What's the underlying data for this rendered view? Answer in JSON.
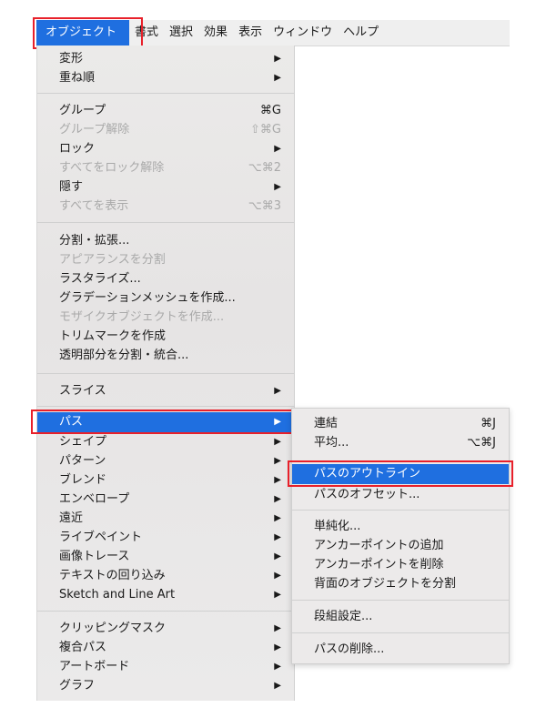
{
  "menubar": {
    "items": [
      {
        "label": "オブジェクト"
      },
      {
        "label": "書式"
      },
      {
        "label": "選択"
      },
      {
        "label": "効果"
      },
      {
        "label": "表示"
      },
      {
        "label": "ウィンドウ"
      },
      {
        "label": "ヘルプ"
      }
    ]
  },
  "menu": {
    "items": [
      {
        "label": "変形",
        "arrow": "▶"
      },
      {
        "label": "重ね順",
        "arrow": "▶"
      },
      {
        "label": "グループ",
        "shortcut": "⌘G"
      },
      {
        "label": "グループ解除",
        "shortcut": "⇧⌘G"
      },
      {
        "label": "ロック",
        "arrow": "▶"
      },
      {
        "label": "すべてをロック解除",
        "shortcut": "⌥⌘2"
      },
      {
        "label": "隠す",
        "arrow": "▶"
      },
      {
        "label": "すべてを表示",
        "shortcut": "⌥⌘3"
      },
      {
        "label": "分割・拡張..."
      },
      {
        "label": "アピアランスを分割"
      },
      {
        "label": "ラスタライズ..."
      },
      {
        "label": "グラデーションメッシュを作成..."
      },
      {
        "label": "モザイクオブジェクトを作成..."
      },
      {
        "label": "トリムマークを作成"
      },
      {
        "label": "透明部分を分割・統合..."
      },
      {
        "label": "スライス",
        "arrow": "▶"
      },
      {
        "label": "パス",
        "arrow": "▶"
      },
      {
        "label": "シェイプ",
        "arrow": "▶"
      },
      {
        "label": "パターン",
        "arrow": "▶"
      },
      {
        "label": "ブレンド",
        "arrow": "▶"
      },
      {
        "label": "エンベロープ",
        "arrow": "▶"
      },
      {
        "label": "遠近",
        "arrow": "▶"
      },
      {
        "label": "ライブペイント",
        "arrow": "▶"
      },
      {
        "label": "画像トレース",
        "arrow": "▶"
      },
      {
        "label": "テキストの回り込み",
        "arrow": "▶"
      },
      {
        "label": "Sketch and Line Art",
        "arrow": "▶"
      },
      {
        "label": "クリッピングマスク",
        "arrow": "▶"
      },
      {
        "label": "複合パス",
        "arrow": "▶"
      },
      {
        "label": "アートボード",
        "arrow": "▶"
      },
      {
        "label": "グラフ",
        "arrow": "▶"
      }
    ]
  },
  "submenu": {
    "items": [
      {
        "label": "連結",
        "shortcut": "⌘J"
      },
      {
        "label": "平均...",
        "shortcut": "⌥⌘J"
      },
      {
        "label": "パスのアウトライン"
      },
      {
        "label": "パスのオフセット..."
      },
      {
        "label": "単純化..."
      },
      {
        "label": "アンカーポイントの追加"
      },
      {
        "label": "アンカーポイントを削除"
      },
      {
        "label": "背面のオブジェクトを分割"
      },
      {
        "label": "段組設定..."
      },
      {
        "label": "パスの削除..."
      }
    ]
  },
  "colors": {
    "highlight": "#1f6fe0",
    "annotation": "#e8202a"
  }
}
